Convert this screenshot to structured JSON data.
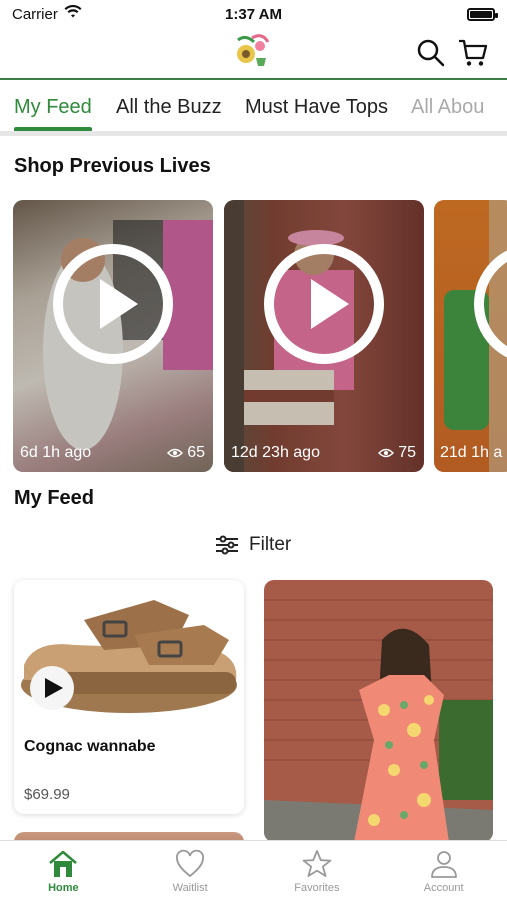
{
  "status": {
    "carrier": "Carrier",
    "time": "1:37 AM"
  },
  "tabs": [
    "My Feed",
    "All the Buzz",
    "Must Have Tops",
    "All Abou"
  ],
  "sections": {
    "previous_lives": "Shop Previous Lives",
    "my_feed": "My Feed"
  },
  "videos": [
    {
      "ago": "6d 1h ago",
      "views": "65"
    },
    {
      "ago": "12d 23h ago",
      "views": "75"
    },
    {
      "ago": "21d 1h a",
      "views": ""
    }
  ],
  "filter": {
    "label": "Filter"
  },
  "products": [
    {
      "name": "Cognac wannabe",
      "price": "$69.99"
    }
  ],
  "tabbar": [
    "Home",
    "Waitlist",
    "Favorites",
    "Account"
  ],
  "colors": {
    "accent": "#2f8a3b",
    "header_line": "#3a7d44"
  },
  "icons": [
    "wifi-icon",
    "battery-icon",
    "search-icon",
    "cart-icon",
    "play-icon",
    "eye-icon",
    "filter-icon",
    "home-icon",
    "heart-icon",
    "star-icon",
    "account-icon"
  ]
}
